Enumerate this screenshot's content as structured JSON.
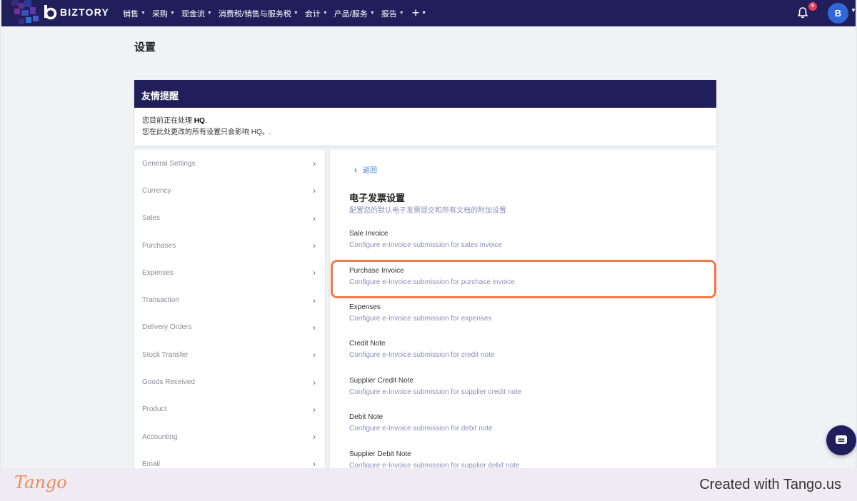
{
  "nav": {
    "brand": "BIZTORY",
    "menu": [
      "销售",
      "采购",
      "现金流",
      "消费税/销售与服务税",
      "会计",
      "产品/服务",
      "报告"
    ],
    "plus_label": "+",
    "notification_count": "9",
    "avatar_letter": "B"
  },
  "page": {
    "title": "设置"
  },
  "notice": {
    "title": "友情提醒",
    "line1_prefix": "您目前正在处理 ",
    "line1_entity": "HQ",
    "line1_suffix": ".",
    "line2": "您在此处更改的所有设置只会影响 HQ。."
  },
  "sidebar": {
    "items": [
      "General Settings",
      "Currency",
      "Sales",
      "Purchases",
      "Expenses",
      "Transaction",
      "Delivery Orders",
      "Stock Transfer",
      "Goods Received",
      "Product",
      "Accounting",
      "Email"
    ]
  },
  "content": {
    "back_label": "返回",
    "section_title": "电子发票设置",
    "section_subtitle": "配置您的默认电子发票提交和所有文档的附加设置",
    "options": [
      {
        "title": "Sale Invoice",
        "desc": "Configure e-Invoice submission for sales invoice"
      },
      {
        "title": "Purchase Invoice",
        "desc": "Configure e-Invoice submission for purchase invoice"
      },
      {
        "title": "Expenses",
        "desc": "Configure e-Invoice submission for expenses"
      },
      {
        "title": "Credit Note",
        "desc": "Configure e-Invoice submission for credit note"
      },
      {
        "title": "Supplier Credit Note",
        "desc": "Configure e-Invoice submission for supplier credit note"
      },
      {
        "title": "Debit Note",
        "desc": "Configure e-Invoice submission for debit note"
      },
      {
        "title": "Supplier Debit Note",
        "desc": "Configure e-Invoice submission for supplier debit note"
      }
    ]
  },
  "footer": {
    "tango_logo": "Tango",
    "created": "Created with Tango.us"
  },
  "colors": {
    "nav_bg": "#211f5b",
    "link": "#3d7bd6",
    "highlight": "#f07a4a"
  }
}
